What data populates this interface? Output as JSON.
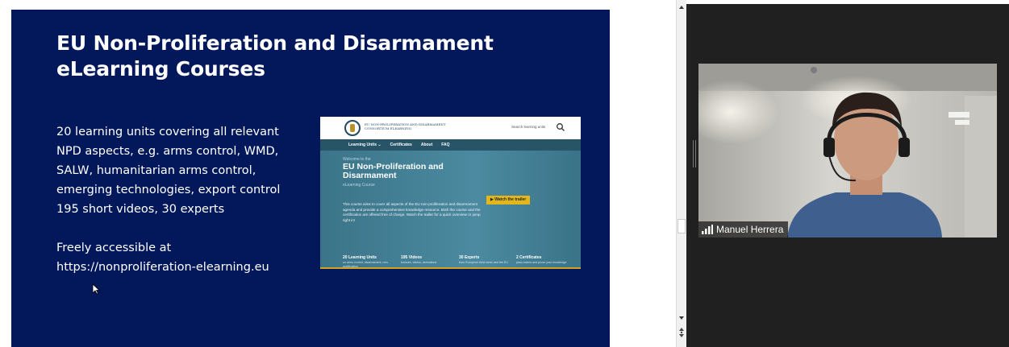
{
  "slide": {
    "title": "EU Non-Proliferation and Disarmament eLearning Courses",
    "bullet_1": "20 learning units covering all relevant NPD aspects, e.g. arms control, WMD, SALW, humanitarian arms control, emerging technologies, export control",
    "bullet_2": "195 short videos, 30 experts",
    "bullet_3_line1": "Freely accessible at",
    "bullet_3_line2": "https://nonproliferation-elearning.eu"
  },
  "website": {
    "logo_text": "EU NON-PROLIFERATION AND DISARMAMENT CONSORTIUM ELEARNING",
    "search_placeholder": "Search learning units",
    "nav": [
      "Learning Units ⌄",
      "Certificates",
      "About",
      "FAQ"
    ],
    "welcome": "Welcome to the",
    "hero_title": "EU Non-Proliferation and Disarmament",
    "course": "eLearning Course",
    "description": "This course aims to cover all aspects of the EU non-proliferation and disarmament agenda and provide a comprehensive knowledge resource. Both the course and the certification are offered free of charge. Watch the trailer for a quick overview or jump right in!",
    "trailer_button": "▶ Watch the trailer",
    "stats": [
      {
        "title": "20 Learning Units",
        "sub": "on arms control, disarmament, non-proliferation"
      },
      {
        "title": "195 Videos",
        "sub": "lectures, videos, animations"
      },
      {
        "title": "30 Experts",
        "sub": "from European think tanks and the EU"
      },
      {
        "title": "2 Certificates",
        "sub": "pass exams and prove your knowledge"
      }
    ],
    "accent_color": "#e5b618"
  },
  "video": {
    "participant_name": "Manuel Herrera",
    "icons": [
      "signal-strength-icon"
    ]
  },
  "colors": {
    "slide_background": "#02185a",
    "panel_background": "#202020"
  }
}
